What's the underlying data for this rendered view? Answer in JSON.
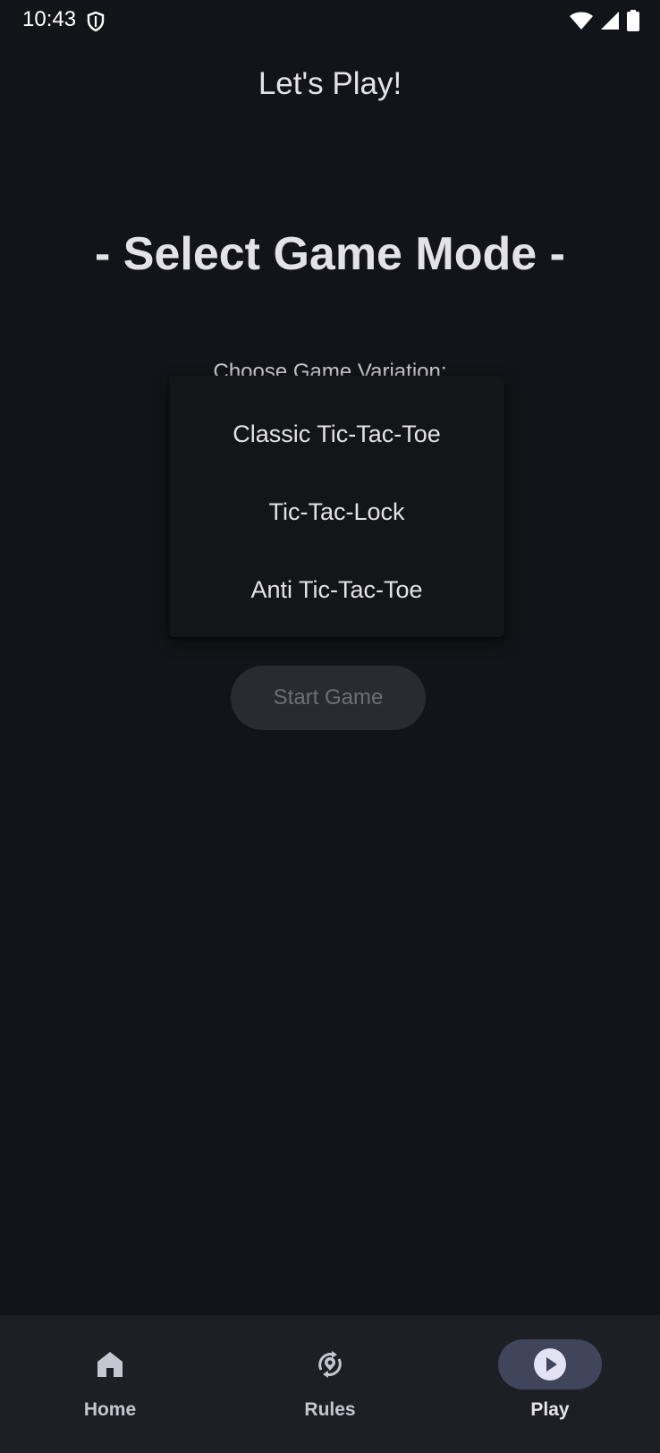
{
  "status_bar": {
    "time": "10:43",
    "icons": [
      "shield-icon",
      "wifi-icon",
      "cellular-signal-icon",
      "battery-icon"
    ]
  },
  "header": {
    "title": "Let's Play!"
  },
  "main": {
    "heading": "- Select Game Mode -",
    "variation_label": "Choose Game Variation:",
    "menu": {
      "items": [
        {
          "label": "Classic Tic-Tac-Toe"
        },
        {
          "label": "Tic-Tac-Lock"
        },
        {
          "label": "Anti Tic-Tac-Toe"
        }
      ]
    },
    "start_button": {
      "label": "Start Game",
      "enabled": false
    }
  },
  "nav": {
    "items": [
      {
        "label": "Home",
        "icon": "home-icon",
        "active": false
      },
      {
        "label": "Rules",
        "icon": "rules-icon",
        "active": false
      },
      {
        "label": "Play",
        "icon": "play-icon",
        "active": true
      }
    ]
  },
  "colors": {
    "background": "#131419",
    "surface": "#1e1f25",
    "text": "#e3e2e8",
    "active_indicator": "#40455b",
    "disabled_button": "#2a2b30"
  }
}
